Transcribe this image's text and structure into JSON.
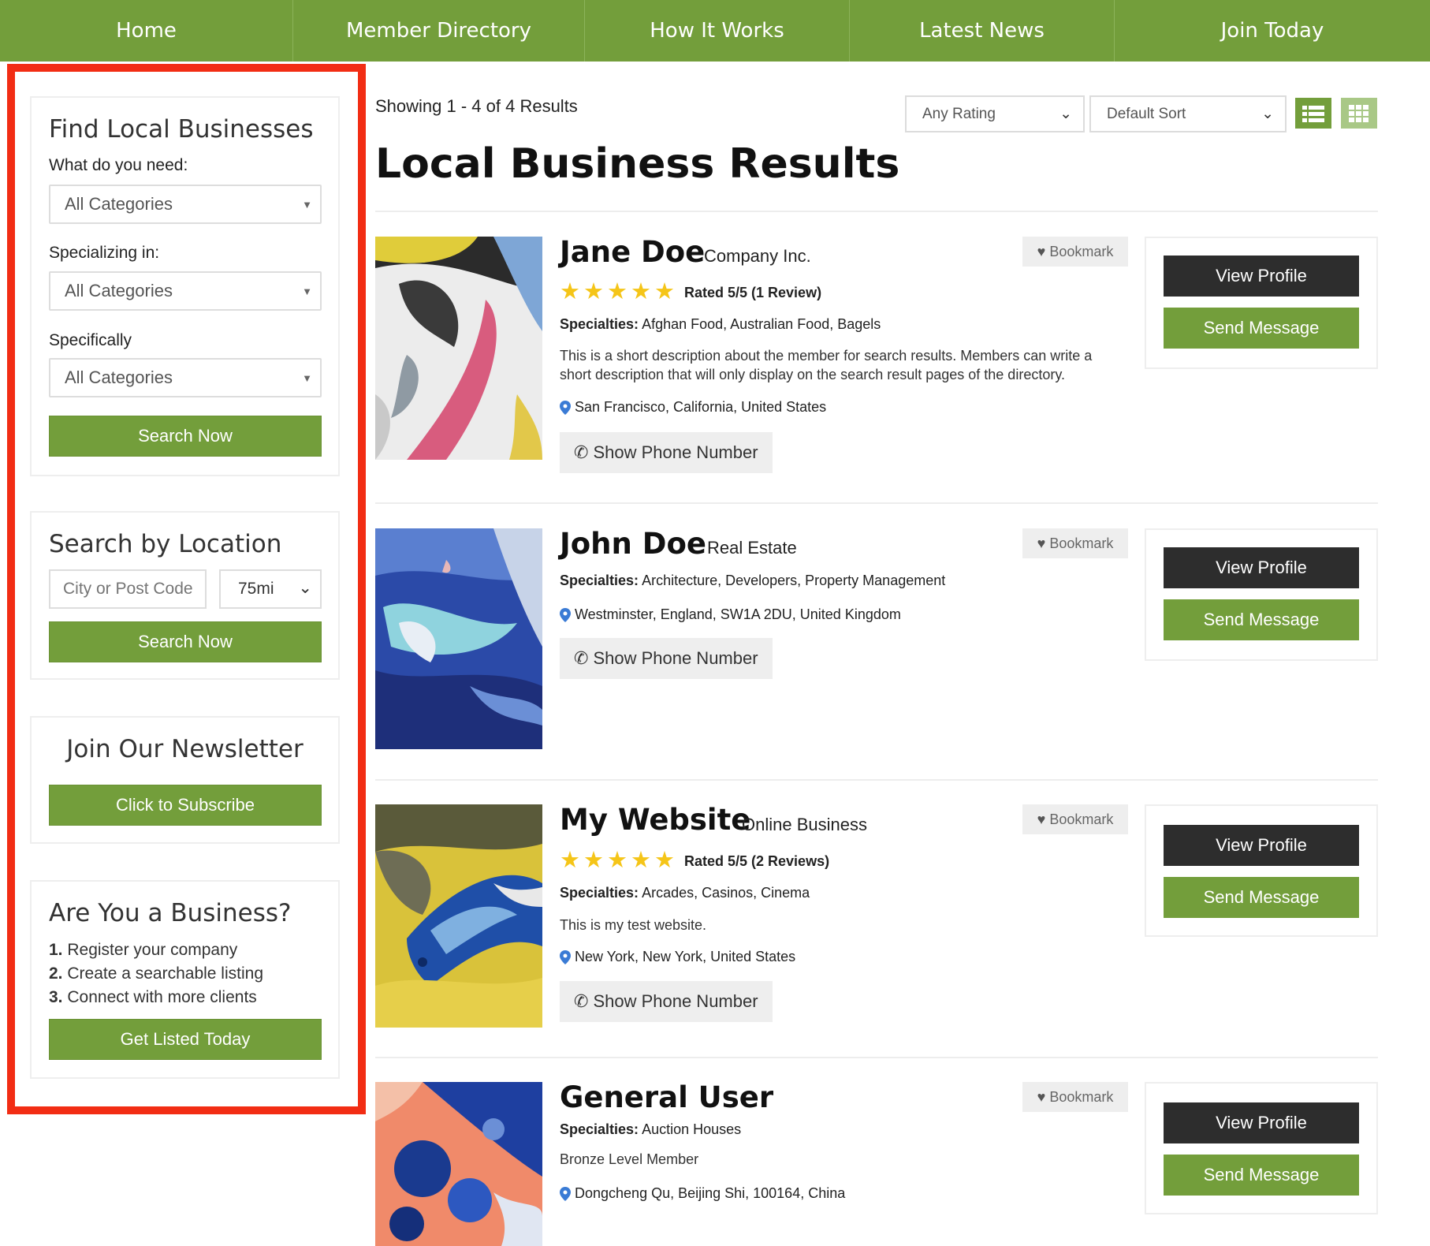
{
  "nav": {
    "items": [
      {
        "label": "Home"
      },
      {
        "label": "Member Directory"
      },
      {
        "label": "How It Works"
      },
      {
        "label": "Latest News"
      },
      {
        "label": "Join Today"
      }
    ]
  },
  "sidebar": {
    "find": {
      "title": "Find Local Businesses",
      "need_label": "What do you need:",
      "need_value": "All Categories",
      "specializing_label": "Specializing in:",
      "specializing_value": "All Categories",
      "specifically_label": "Specifically",
      "specifically_value": "All Categories",
      "search_label": "Search Now"
    },
    "location": {
      "title": "Search by Location",
      "placeholder": "City or Post Code",
      "radius": "75mi",
      "search_label": "Search Now"
    },
    "newsletter": {
      "title": "Join Our Newsletter",
      "subscribe_label": "Click to Subscribe"
    },
    "business": {
      "title": "Are You a Business?",
      "steps": [
        {
          "num": "1.",
          "text": "Register your company"
        },
        {
          "num": "2.",
          "text": "Create a searchable listing"
        },
        {
          "num": "3.",
          "text": "Connect with more clients"
        }
      ],
      "cta_label": "Get Listed Today"
    }
  },
  "main": {
    "showing": "Showing 1 - 4 of 4 Results",
    "title": "Local Business Results",
    "rating_filter": "Any Rating",
    "sort_filter": "Default Sort",
    "results": [
      {
        "name": "Jane Doe",
        "company": "Company Inc.",
        "rating_text": "Rated 5/5 (1 Review)",
        "specialties_label": "Specialties:",
        "specialties": "Afghan Food, Australian Food, Bagels",
        "description": "This is a short description about the member for search results. Members can write a short description that will only display on the search result pages of the directory.",
        "location": "San Francisco, California, United States",
        "phone_label": "Show Phone Number",
        "bookmark_label": "Bookmark",
        "view_label": "View Profile",
        "message_label": "Send Message"
      },
      {
        "name": "John Doe",
        "company": "Real Estate",
        "specialties_label": "Specialties:",
        "specialties": "Architecture, Developers, Property Management",
        "location": "Westminster, England, SW1A 2DU, United Kingdom",
        "phone_label": "Show Phone Number",
        "bookmark_label": "Bookmark",
        "view_label": "View Profile",
        "message_label": "Send Message"
      },
      {
        "name": "My Website",
        "company": "Online Business",
        "rating_text": "Rated 5/5 (2 Reviews)",
        "specialties_label": "Specialties:",
        "specialties": "Arcades, Casinos, Cinema",
        "description": "This is my test website.",
        "location": "New York, New York, United States",
        "phone_label": "Show Phone Number",
        "bookmark_label": "Bookmark",
        "view_label": "View Profile",
        "message_label": "Send Message"
      },
      {
        "name": "General User",
        "specialties_label": "Specialties:",
        "specialties": "Auction Houses",
        "description": "Bronze Level Member",
        "location": "Dongcheng Qu, Beijing Shi, 100164, China",
        "bookmark_label": "Bookmark",
        "view_label": "View Profile",
        "message_label": "Send Message"
      }
    ]
  },
  "icons": {
    "star": "star-icon",
    "pin": "map-pin-icon",
    "phone": "phone-icon",
    "heart": "heart-icon",
    "list_view": "list-view-icon",
    "grid_view": "grid-view-icon"
  },
  "colors": {
    "brand_green": "#739e3b",
    "dark_button": "#2d2d2d",
    "highlight_red": "#f22d14",
    "star_yellow": "#f5c518",
    "pin_blue": "#3a7bd5"
  }
}
